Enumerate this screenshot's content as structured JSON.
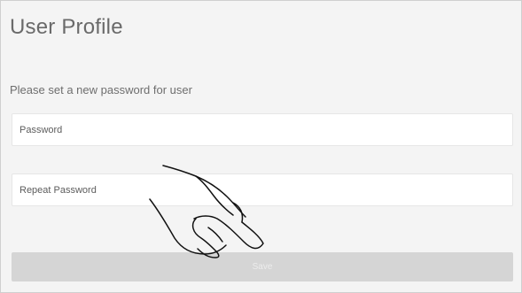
{
  "page": {
    "title": "User Profile",
    "instruction": "Please set a new password for user"
  },
  "form": {
    "password_placeholder": "Password",
    "repeat_password_placeholder": "Repeat Password",
    "save_label": "Save",
    "save_enabled": false
  },
  "colors": {
    "background": "#f4f4f4",
    "field_background": "#ffffff",
    "button_disabled": "#d5d5d5",
    "title_text": "#6a6a6a"
  },
  "overlay": {
    "icon": "pointing-hand-icon"
  }
}
